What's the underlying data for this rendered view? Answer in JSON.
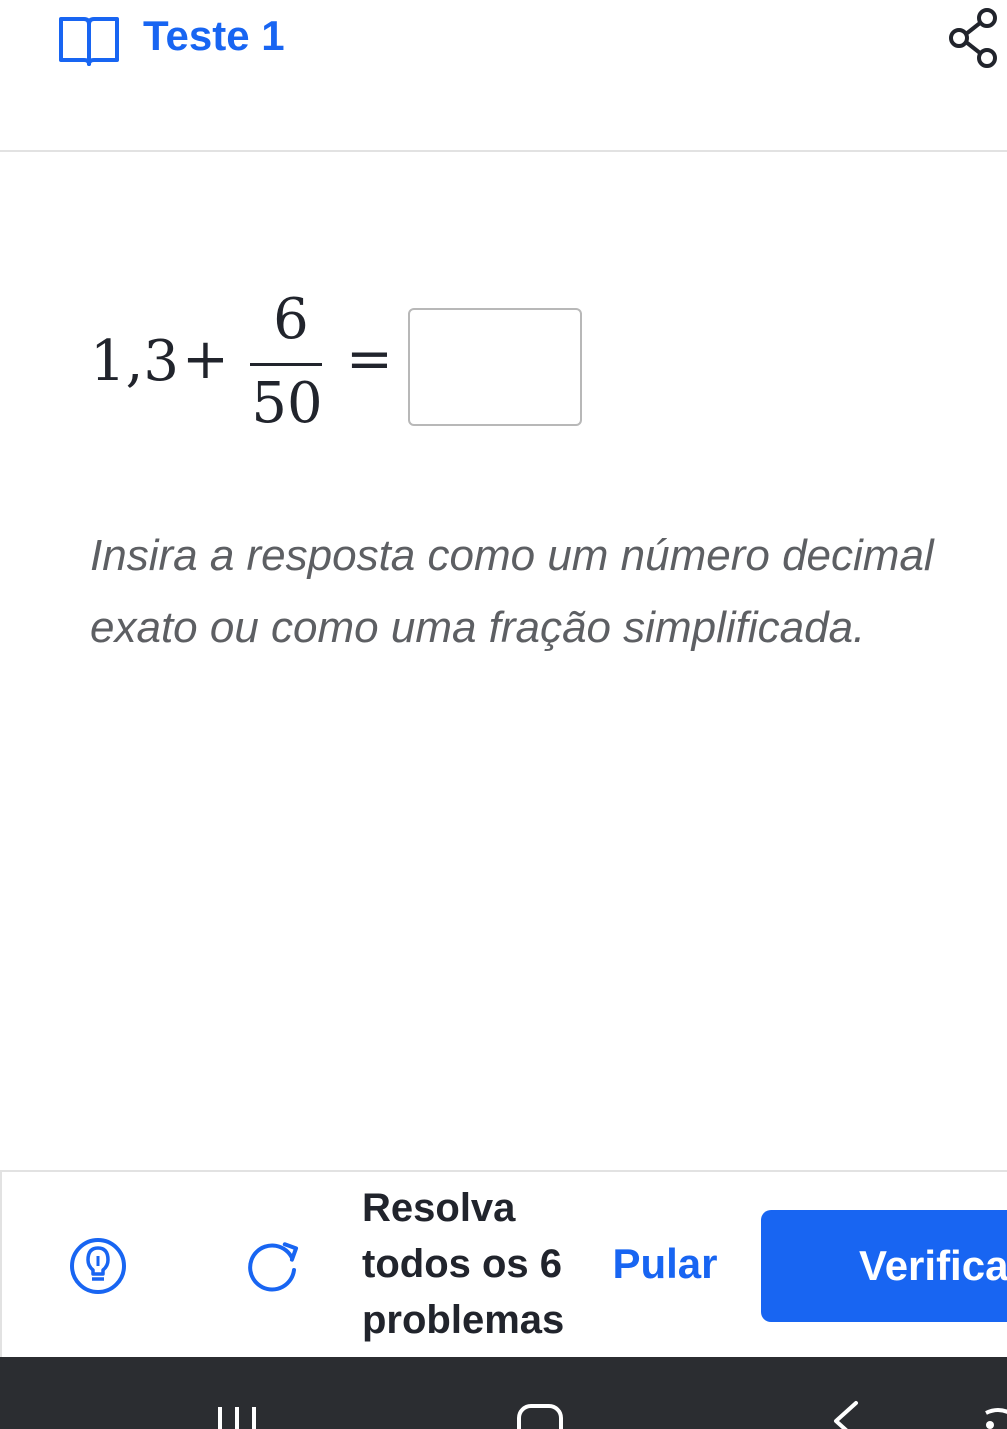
{
  "header": {
    "title": "Teste 1",
    "icons": {
      "left": "open-book-icon",
      "right": "share-icon"
    }
  },
  "problem": {
    "whole": "1,3",
    "operator": "+",
    "numerator": "6",
    "denominator": "50",
    "equals": "=",
    "answer_value": "",
    "instructions": "Insira a resposta como um número decimal exato ou como uma fração simplificada."
  },
  "toolbar": {
    "solve_all_label": "Resolva todos os 6 problemas",
    "skip_label": "Pular",
    "check_label": "Verifica",
    "icons": {
      "hint": "hint-lightbulb-icon",
      "redo": "redo-icon"
    }
  },
  "colors": {
    "accent": "#1865f2",
    "text": "#21242c",
    "instructions_text": "#5d5f63",
    "navbar": "#2b2d31"
  }
}
